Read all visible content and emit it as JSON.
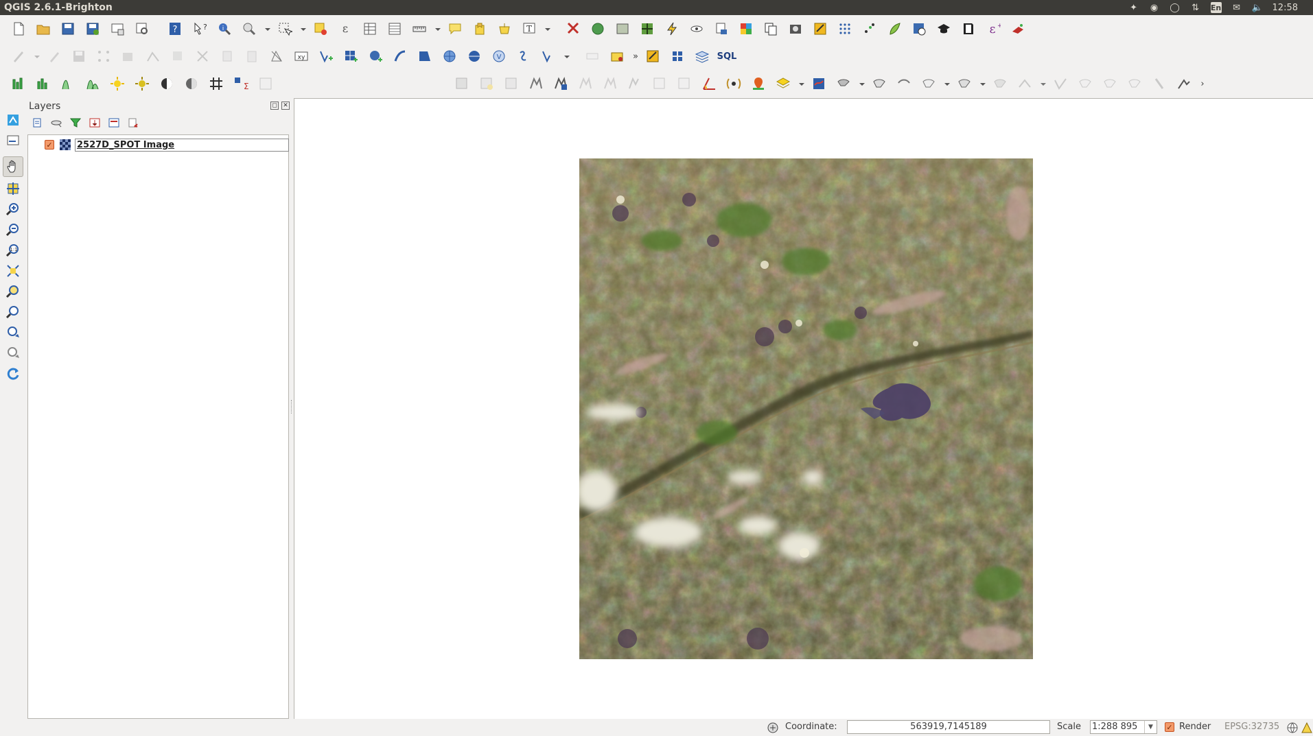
{
  "window": {
    "title": "QGIS 2.6.1-Brighton"
  },
  "system_tray": {
    "language": "En",
    "clock": "12:58",
    "icons": [
      "dropbox-icon",
      "ubuntu-one-icon",
      "chat-icon",
      "network-icon",
      "keyboard-language-icon",
      "mail-icon",
      "volume-icon"
    ]
  },
  "toolbars": {
    "file": [
      "new-project-icon",
      "open-project-icon",
      "save-project-icon",
      "save-as-icon",
      "new-print-composer-icon",
      "composer-manager-icon"
    ],
    "navigation": [
      "help-icon",
      "whats-this-icon",
      "identify-icon",
      "zoom-tool-icon",
      "select-features-icon",
      "deselect-icon",
      "expression-select-icon",
      "attribute-table-icon",
      "field-calculator-icon",
      "measure-icon",
      "map-tips-icon",
      "new-bookmark-icon",
      "show-bookmarks-icon",
      "text-annotation-icon"
    ],
    "plugins": [
      "geoprocessing-icon",
      "openlayers-icon",
      "georeferencer-icon",
      "grid-icon",
      "lightning-icon",
      "eye-icon",
      "data-export-icon",
      "color-ramp-icon",
      "copy-icon",
      "photo-icon",
      "map-tools-icon",
      "dot-grid-icon",
      "scatter-icon",
      "qgis-cloud-icon",
      "database-icon",
      "hat-icon",
      "book-icon",
      "expression-icon",
      "digitize-icon"
    ],
    "sql_label": "SQL"
  },
  "layers_panel": {
    "title": "Layers",
    "layer": {
      "name": "2527D_SPOT Image",
      "visible": true
    }
  },
  "status_bar": {
    "coordinate_label": "Coordinate:",
    "coordinate_value": "563919,7145189",
    "scale_label": "Scale",
    "scale_value": "1:288 895",
    "render_label": "Render",
    "render_checked": true,
    "crs": "EPSG:32735"
  },
  "colors": {
    "panel_bg": "#f2f1f0",
    "topbar_bg": "#3c3b37",
    "canvas_bg": "#ffffff",
    "checkbox_orange": "#f39a6a"
  }
}
